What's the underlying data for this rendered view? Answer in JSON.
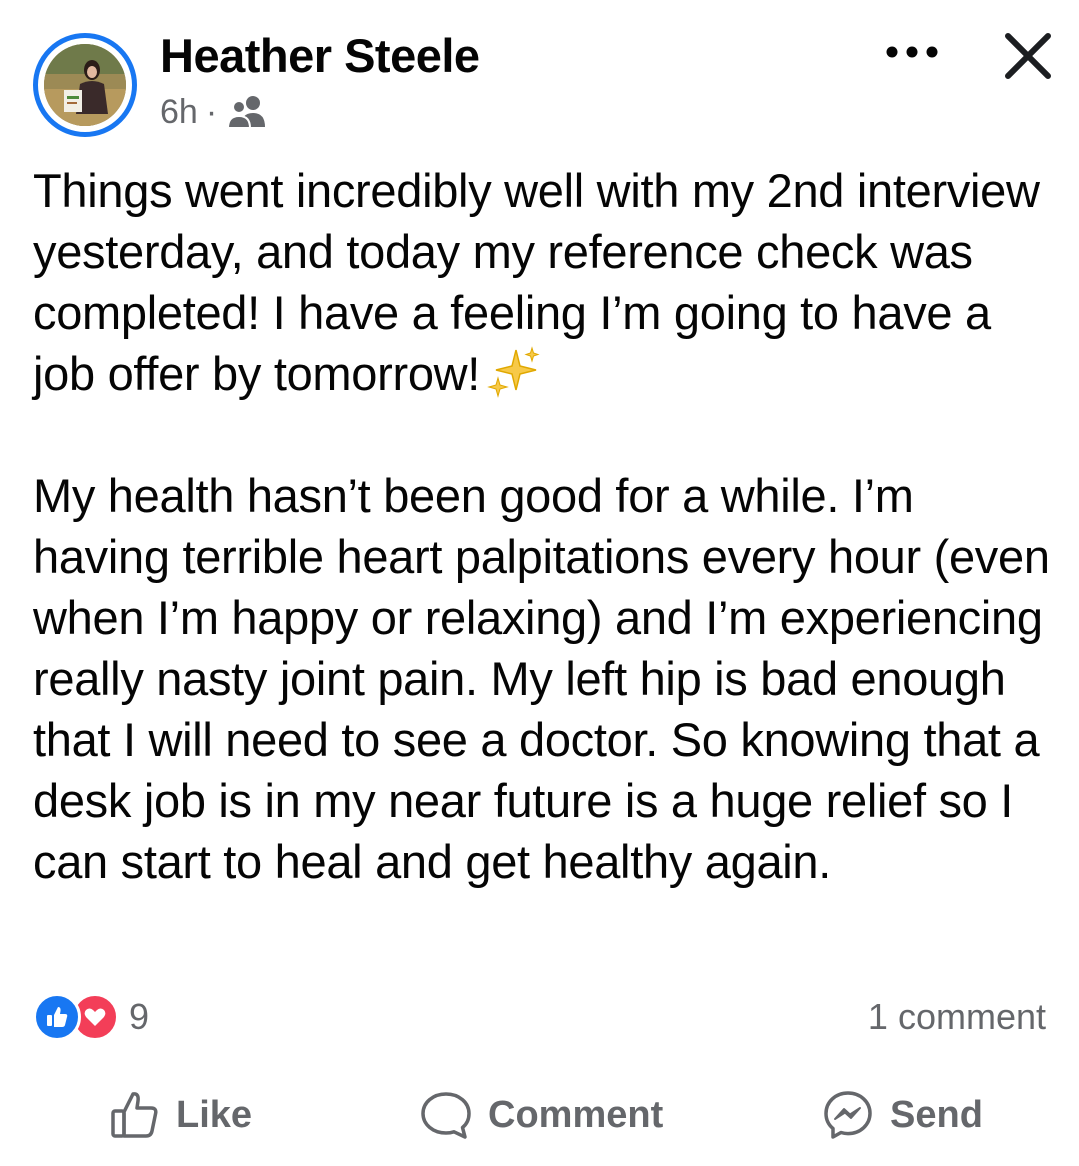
{
  "post": {
    "author": "Heather Steele",
    "time": "6h",
    "separator": "·",
    "audience_icon": "friends-icon",
    "paragraph1": "Things went incredibly well with my 2nd interview yesterday, and today my reference check was completed! I have a feeling I’m going to have a job offer by tomorrow!",
    "paragraph1_emoji": "sparkles-icon",
    "paragraph2": "My health hasn’t been good for a while. I’m having terrible heart palpitations every hour (even when I’m happy or relaxing) and I’m experiencing really nasty joint pain. My left hip is bad enough that I will need to see a doctor. So knowing that a desk job is in my near future is a huge relief so I can start to heal and get healthy again."
  },
  "reactions": {
    "icons": [
      "like-reaction-icon",
      "love-reaction-icon"
    ],
    "count": "9",
    "comments": "1 comment"
  },
  "actions": {
    "like": "Like",
    "comment": "Comment",
    "send": "Send"
  },
  "colors": {
    "accent": "#1877f2",
    "love": "#f33e58",
    "secondary_text": "#65676b",
    "text": "#050505"
  }
}
